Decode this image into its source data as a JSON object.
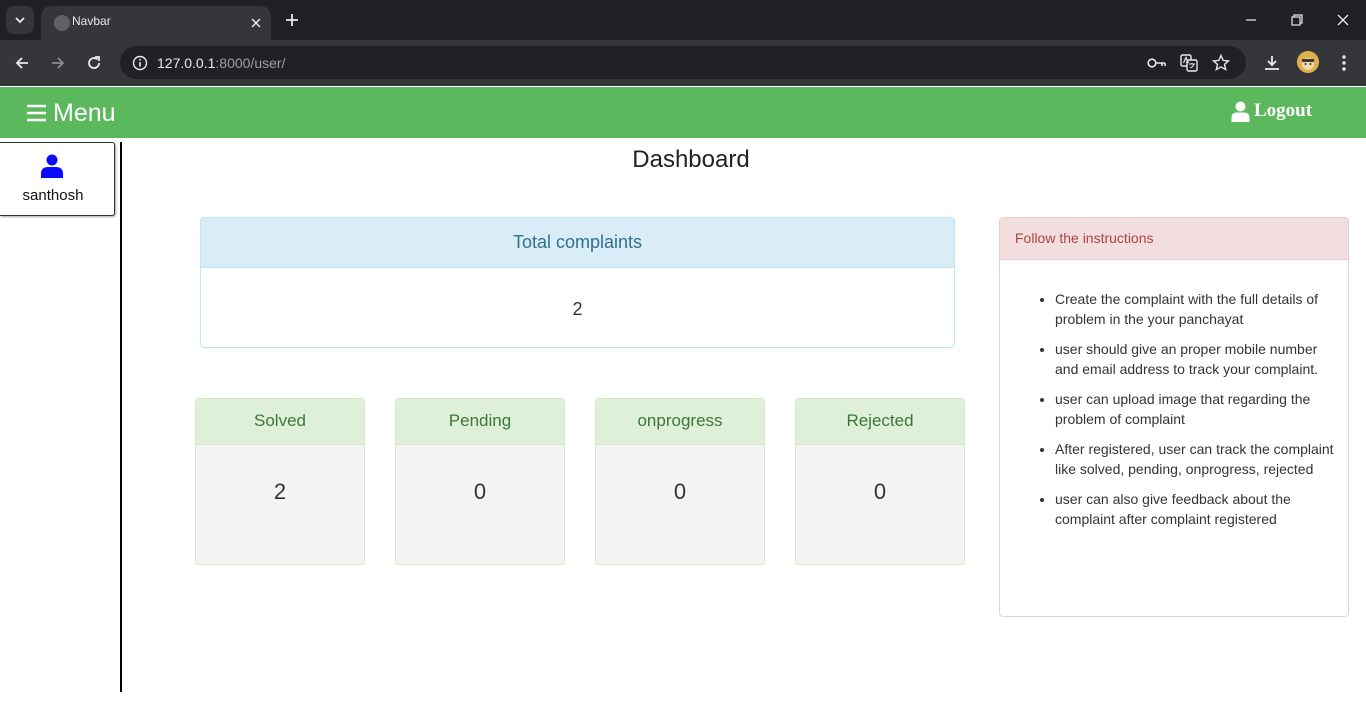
{
  "browser": {
    "tab_title": "Navbar",
    "url_host": "127.0.0.1",
    "url_path": ":8000/user/"
  },
  "navbar": {
    "menu_label": "Menu",
    "logout_label": "Logout",
    "color": "#5cb85c"
  },
  "sidebar": {
    "username": "santhosh"
  },
  "dashboard": {
    "title": "Dashboard",
    "total": {
      "label": "Total complaints",
      "value": "2"
    },
    "stats": [
      {
        "label": "Solved",
        "value": "2"
      },
      {
        "label": "Pending",
        "value": "0"
      },
      {
        "label": "onprogress",
        "value": "0"
      },
      {
        "label": "Rejected",
        "value": "0"
      }
    ]
  },
  "instructions": {
    "title": "Follow the instructions",
    "items": [
      "Create the complaint with the full details of problem in the your panchayat",
      "user should give an proper mobile number and email address to track your complaint.",
      "user can upload image that regarding the problem of complaint",
      "After registered, user can track the complaint like solved, pending, onprogress, rejected",
      "user can also give feedback about the complaint after complaint registered"
    ]
  }
}
